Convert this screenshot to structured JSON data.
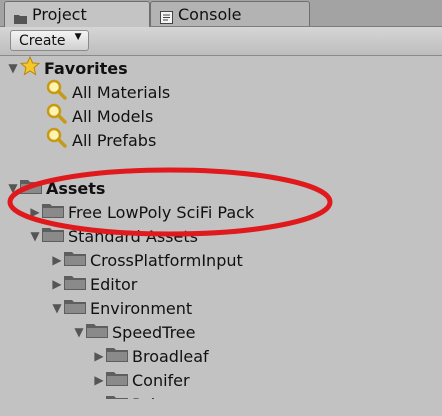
{
  "tabs": [
    {
      "label": "Project",
      "icon": "folder-icon",
      "active": true
    },
    {
      "label": "Console",
      "icon": "console-icon",
      "active": false
    }
  ],
  "toolbar": {
    "create_label": "Create"
  },
  "favorites": {
    "label": "Favorites",
    "items": [
      {
        "label": "All Materials"
      },
      {
        "label": "All Models"
      },
      {
        "label": "All Prefabs"
      }
    ]
  },
  "assets": {
    "label": "Assets",
    "items": [
      {
        "label": "Free LowPoly SciFi Pack",
        "expanded": false
      },
      {
        "label": "Standard Assets",
        "expanded": true
      },
      {
        "label": "CrossPlatformInput",
        "expanded": false
      },
      {
        "label": "Editor",
        "expanded": false
      },
      {
        "label": "Environment",
        "expanded": true
      },
      {
        "label": "SpeedTree",
        "expanded": true
      },
      {
        "label": "Broadleaf",
        "expanded": false
      },
      {
        "label": "Conifer",
        "expanded": false
      },
      {
        "label": "Palm",
        "expanded": false
      }
    ]
  },
  "colors": {
    "highlight_ellipse": "#e0191c",
    "panel_bg": "#c2c2c2"
  }
}
